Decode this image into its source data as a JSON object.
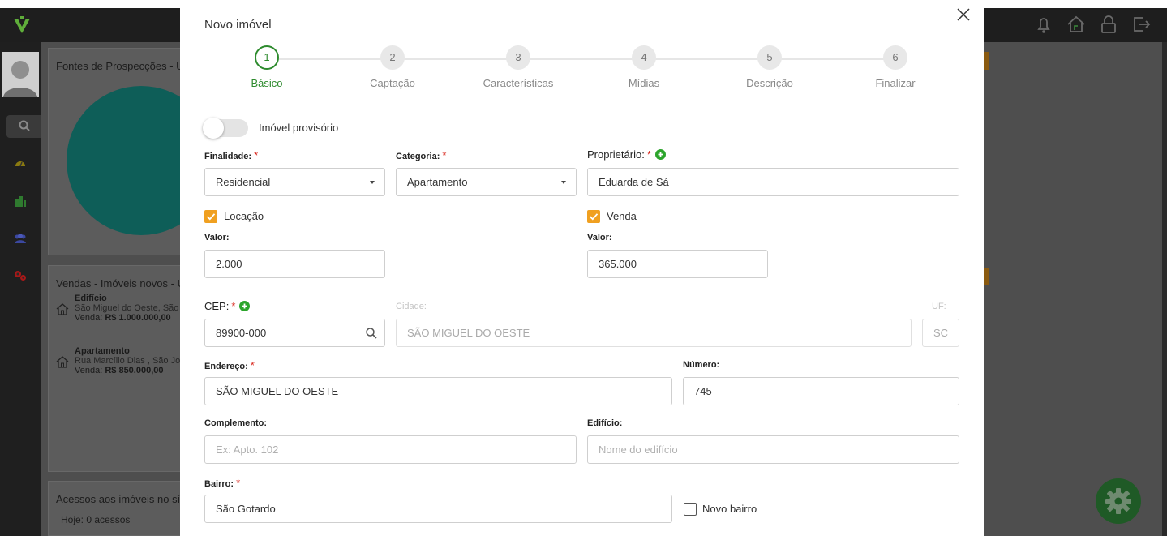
{
  "background": {
    "card1_title": "Fontes de Prospecções - U",
    "card2_title": "Vendas - Imóveis novos - U",
    "card3_title": "Acessos aos imóveis no sí",
    "card3_today_label": "Hoje:",
    "card3_today_value": "0 acessos",
    "properties": [
      {
        "type": "Edifício",
        "address": "São Miguel do Oeste, São",
        "price_label": "Venda:",
        "price": "R$ 1.000.000,00"
      },
      {
        "type": "Apartamento",
        "address": "Rua Marcílio Dias , São Jo",
        "price_label": "Venda:",
        "price": "R$ 850.000,00"
      }
    ]
  },
  "modal": {
    "title": "Novo imóvel",
    "steps": [
      {
        "num": "1",
        "label": "Básico",
        "active": true
      },
      {
        "num": "2",
        "label": "Captação",
        "active": false
      },
      {
        "num": "3",
        "label": "Características",
        "active": false
      },
      {
        "num": "4",
        "label": "Mídias",
        "active": false
      },
      {
        "num": "5",
        "label": "Descrição",
        "active": false
      },
      {
        "num": "6",
        "label": "Finalizar",
        "active": false
      }
    ],
    "provisional_label": "Imóvel provisório",
    "provisional_on": false,
    "finalidade": {
      "label": "Finalidade:",
      "value": "Residencial"
    },
    "categoria": {
      "label": "Categoria:",
      "value": "Apartamento"
    },
    "proprietario": {
      "label": "Proprietário:",
      "value": "Eduarda de Sá"
    },
    "locacao": {
      "label": "Locação",
      "checked": true,
      "valor_label": "Valor:",
      "valor": "2.000"
    },
    "venda": {
      "label": "Venda",
      "checked": true,
      "valor_label": "Valor:",
      "valor": "365.000"
    },
    "cep": {
      "label": "CEP:",
      "value": "89900-000"
    },
    "cidade": {
      "label": "Cidade:",
      "value": "SÃO MIGUEL DO OESTE"
    },
    "uf": {
      "label": "UF:",
      "value": "SC"
    },
    "endereco": {
      "label": "Endereço:",
      "value": "SÃO MIGUEL DO OESTE"
    },
    "numero": {
      "label": "Número:",
      "value": "745"
    },
    "complemento": {
      "label": "Complemento:",
      "placeholder": "Ex: Apto. 102"
    },
    "edificio": {
      "label": "Edifício:",
      "placeholder": "Nome do edifício"
    },
    "bairro": {
      "label": "Bairro:",
      "value": "São Gotardo"
    },
    "novo_bairro": {
      "label": "Novo bairro",
      "checked": false
    }
  },
  "colors": {
    "accent_green": "#2e8b2e",
    "checkbox_orange": "#f0a020",
    "required_red": "#d9261c",
    "teal_pie": "#0e5e58"
  }
}
